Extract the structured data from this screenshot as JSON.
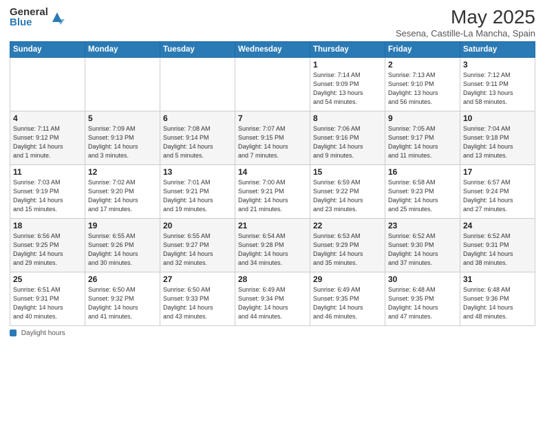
{
  "logo": {
    "general": "General",
    "blue": "Blue"
  },
  "title": "May 2025",
  "subtitle": "Sesena, Castille-La Mancha, Spain",
  "days_of_week": [
    "Sunday",
    "Monday",
    "Tuesday",
    "Wednesday",
    "Thursday",
    "Friday",
    "Saturday"
  ],
  "footer": {
    "label": "Daylight hours"
  },
  "weeks": [
    [
      {
        "day": "",
        "info": ""
      },
      {
        "day": "",
        "info": ""
      },
      {
        "day": "",
        "info": ""
      },
      {
        "day": "",
        "info": ""
      },
      {
        "day": "1",
        "info": "Sunrise: 7:14 AM\nSunset: 9:09 PM\nDaylight: 13 hours\nand 54 minutes."
      },
      {
        "day": "2",
        "info": "Sunrise: 7:13 AM\nSunset: 9:10 PM\nDaylight: 13 hours\nand 56 minutes."
      },
      {
        "day": "3",
        "info": "Sunrise: 7:12 AM\nSunset: 9:11 PM\nDaylight: 13 hours\nand 58 minutes."
      }
    ],
    [
      {
        "day": "4",
        "info": "Sunrise: 7:11 AM\nSunset: 9:12 PM\nDaylight: 14 hours\nand 1 minute."
      },
      {
        "day": "5",
        "info": "Sunrise: 7:09 AM\nSunset: 9:13 PM\nDaylight: 14 hours\nand 3 minutes."
      },
      {
        "day": "6",
        "info": "Sunrise: 7:08 AM\nSunset: 9:14 PM\nDaylight: 14 hours\nand 5 minutes."
      },
      {
        "day": "7",
        "info": "Sunrise: 7:07 AM\nSunset: 9:15 PM\nDaylight: 14 hours\nand 7 minutes."
      },
      {
        "day": "8",
        "info": "Sunrise: 7:06 AM\nSunset: 9:16 PM\nDaylight: 14 hours\nand 9 minutes."
      },
      {
        "day": "9",
        "info": "Sunrise: 7:05 AM\nSunset: 9:17 PM\nDaylight: 14 hours\nand 11 minutes."
      },
      {
        "day": "10",
        "info": "Sunrise: 7:04 AM\nSunset: 9:18 PM\nDaylight: 14 hours\nand 13 minutes."
      }
    ],
    [
      {
        "day": "11",
        "info": "Sunrise: 7:03 AM\nSunset: 9:19 PM\nDaylight: 14 hours\nand 15 minutes."
      },
      {
        "day": "12",
        "info": "Sunrise: 7:02 AM\nSunset: 9:20 PM\nDaylight: 14 hours\nand 17 minutes."
      },
      {
        "day": "13",
        "info": "Sunrise: 7:01 AM\nSunset: 9:21 PM\nDaylight: 14 hours\nand 19 minutes."
      },
      {
        "day": "14",
        "info": "Sunrise: 7:00 AM\nSunset: 9:21 PM\nDaylight: 14 hours\nand 21 minutes."
      },
      {
        "day": "15",
        "info": "Sunrise: 6:59 AM\nSunset: 9:22 PM\nDaylight: 14 hours\nand 23 minutes."
      },
      {
        "day": "16",
        "info": "Sunrise: 6:58 AM\nSunset: 9:23 PM\nDaylight: 14 hours\nand 25 minutes."
      },
      {
        "day": "17",
        "info": "Sunrise: 6:57 AM\nSunset: 9:24 PM\nDaylight: 14 hours\nand 27 minutes."
      }
    ],
    [
      {
        "day": "18",
        "info": "Sunrise: 6:56 AM\nSunset: 9:25 PM\nDaylight: 14 hours\nand 29 minutes."
      },
      {
        "day": "19",
        "info": "Sunrise: 6:55 AM\nSunset: 9:26 PM\nDaylight: 14 hours\nand 30 minutes."
      },
      {
        "day": "20",
        "info": "Sunrise: 6:55 AM\nSunset: 9:27 PM\nDaylight: 14 hours\nand 32 minutes."
      },
      {
        "day": "21",
        "info": "Sunrise: 6:54 AM\nSunset: 9:28 PM\nDaylight: 14 hours\nand 34 minutes."
      },
      {
        "day": "22",
        "info": "Sunrise: 6:53 AM\nSunset: 9:29 PM\nDaylight: 14 hours\nand 35 minutes."
      },
      {
        "day": "23",
        "info": "Sunrise: 6:52 AM\nSunset: 9:30 PM\nDaylight: 14 hours\nand 37 minutes."
      },
      {
        "day": "24",
        "info": "Sunrise: 6:52 AM\nSunset: 9:31 PM\nDaylight: 14 hours\nand 38 minutes."
      }
    ],
    [
      {
        "day": "25",
        "info": "Sunrise: 6:51 AM\nSunset: 9:31 PM\nDaylight: 14 hours\nand 40 minutes."
      },
      {
        "day": "26",
        "info": "Sunrise: 6:50 AM\nSunset: 9:32 PM\nDaylight: 14 hours\nand 41 minutes."
      },
      {
        "day": "27",
        "info": "Sunrise: 6:50 AM\nSunset: 9:33 PM\nDaylight: 14 hours\nand 43 minutes."
      },
      {
        "day": "28",
        "info": "Sunrise: 6:49 AM\nSunset: 9:34 PM\nDaylight: 14 hours\nand 44 minutes."
      },
      {
        "day": "29",
        "info": "Sunrise: 6:49 AM\nSunset: 9:35 PM\nDaylight: 14 hours\nand 46 minutes."
      },
      {
        "day": "30",
        "info": "Sunrise: 6:48 AM\nSunset: 9:35 PM\nDaylight: 14 hours\nand 47 minutes."
      },
      {
        "day": "31",
        "info": "Sunrise: 6:48 AM\nSunset: 9:36 PM\nDaylight: 14 hours\nand 48 minutes."
      }
    ]
  ]
}
